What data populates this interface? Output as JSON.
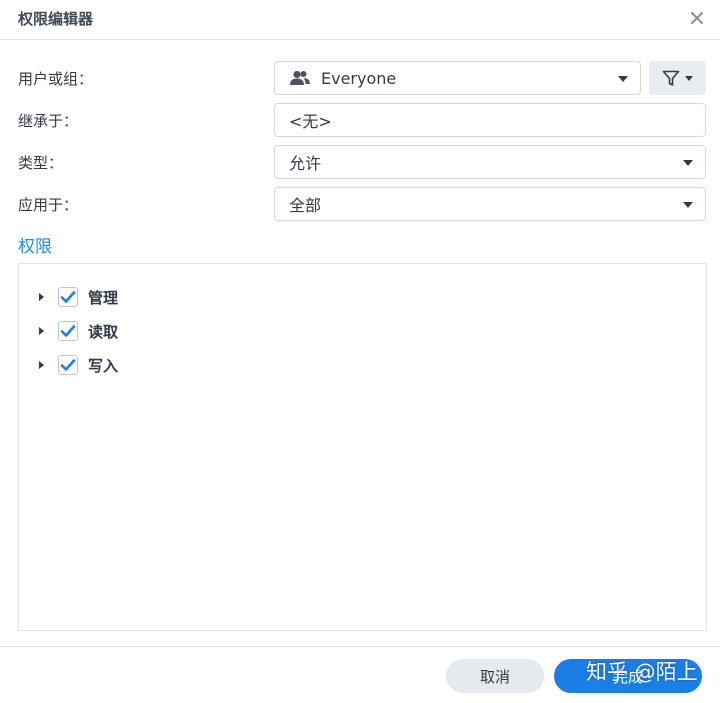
{
  "dialog": {
    "title": "权限编辑器"
  },
  "form": {
    "user_group": {
      "label": "用户或组：",
      "value": "Everyone",
      "icon": "users-icon"
    },
    "inherit": {
      "label": "继承于：",
      "value": "<无>"
    },
    "type": {
      "label": "类型：",
      "value": "允许"
    },
    "apply_to": {
      "label": "应用于：",
      "value": "全部"
    },
    "filter_icon": "filter-icon"
  },
  "permissions": {
    "section_title": "权限",
    "items": [
      {
        "label": "管理",
        "checked": true
      },
      {
        "label": "读取",
        "checked": true
      },
      {
        "label": "写入",
        "checked": true
      }
    ]
  },
  "footer": {
    "cancel_label": "取消",
    "done_label": "完成"
  },
  "watermark": "知乎 @陌上",
  "colors": {
    "accent": "#1e8ce6",
    "primary_button": "#1a7ee6",
    "checkbox_check": "#1a7ee6"
  }
}
